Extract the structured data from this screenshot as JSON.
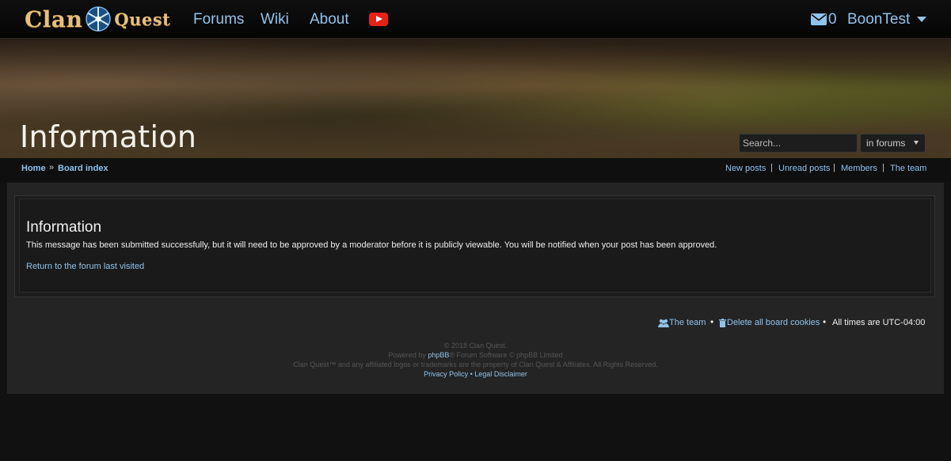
{
  "header": {
    "logo": {
      "word1": "Clan",
      "word2": "Quest"
    },
    "nav": [
      {
        "label": "Forums"
      },
      {
        "label": "Wiki"
      },
      {
        "label": "About"
      }
    ],
    "youtube_icon": "youtube-icon",
    "messages_count": "0",
    "username": "BoonTest"
  },
  "page": {
    "heading": "Information",
    "search": {
      "placeholder": "Search...",
      "scope": "in forums"
    }
  },
  "breadcrumb": {
    "items": [
      "Home",
      "Board index"
    ],
    "separator": "»"
  },
  "quick_links": [
    "New posts",
    "Unread posts",
    "Members",
    "The team"
  ],
  "message": {
    "title": "Information",
    "body": "This message has been submitted successfully, but it will need to be approved by a moderator before it is publicly viewable. You will be notified when your post has been approved.",
    "return_link": "Return to the forum last visited"
  },
  "footer": {
    "team_link": "The team",
    "cookies_link": "Delete all board cookies",
    "timezone": "All times are UTC-04:00",
    "copyright": "© 2018 Clan Quest.",
    "powered_prefix": "Powered by ",
    "phpbb": "phpBB",
    "powered_suffix": "® Forum Software © phpBB Limited",
    "trademark": "Clan Quest™ and any affiliated logos or trademarks are the property of Clan Quest & Affiliates. All Rights Reserved.",
    "privacy": "Privacy Policy",
    "legal": "Legal Disclaimer",
    "legal_sep": "•"
  },
  "colors": {
    "link": "#8fc3ec",
    "background": "#121111",
    "youtube": "#e62117"
  }
}
